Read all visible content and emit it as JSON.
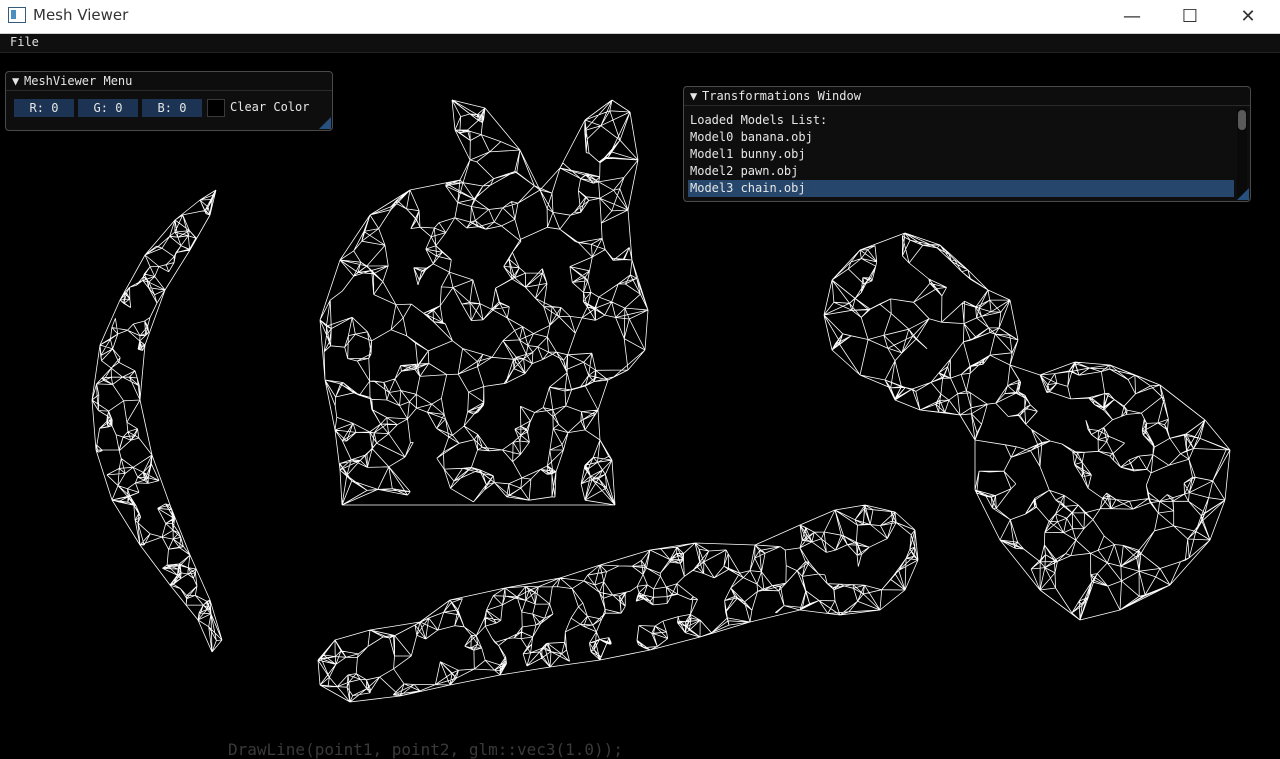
{
  "window": {
    "title": "Mesh Viewer",
    "minimize": "—",
    "maximize": "☐",
    "close": "✕"
  },
  "menubar": {
    "file": "File"
  },
  "meshviewer_menu": {
    "title": "MeshViewer Menu",
    "r_field": "R: 0",
    "g_field": "G: 0",
    "b_field": "B: 0",
    "clear_color_label": "Clear Color"
  },
  "transformations": {
    "title": "Transformations Window",
    "list_header": "Loaded Models List:",
    "models": [
      "Model0 banana.obj",
      "Model1 bunny.obj",
      "Model2 pawn.obj",
      "Model3 chain.obj"
    ],
    "selected_index": 3
  },
  "background_code": "DrawLine(point1, point2, glm::vec3(1.0));",
  "colors": {
    "accent": "#26466c",
    "field_bg": "#1d3354",
    "canvas": "#000000",
    "wire": "#ffffff"
  }
}
